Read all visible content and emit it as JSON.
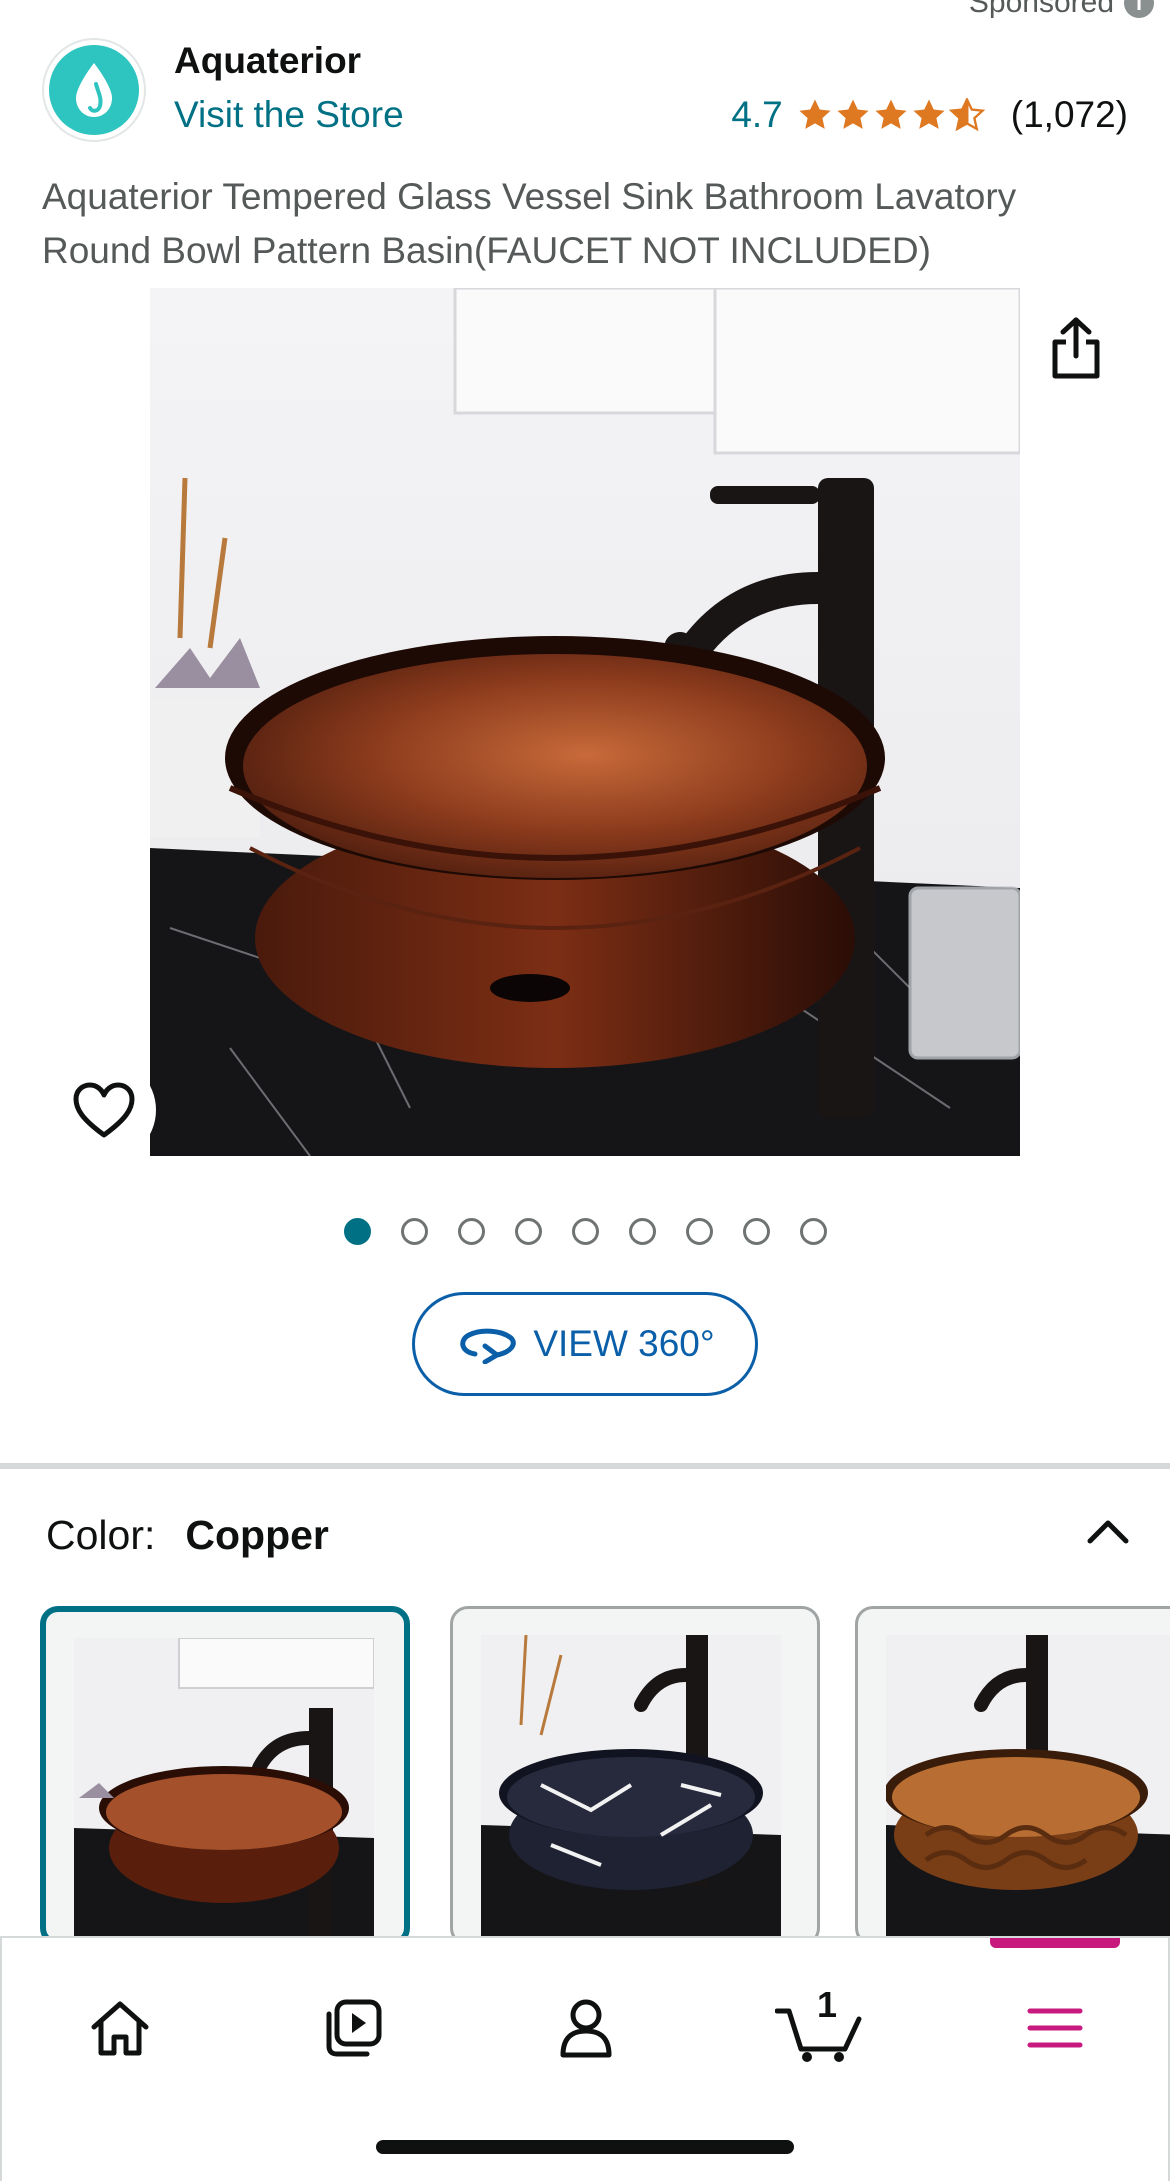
{
  "header": {
    "sponsored_label": "Sponsored",
    "brand_name": "Aquaterior",
    "visit_store_label": "Visit the Store",
    "rating_value": "4.7",
    "rating_stars": 4.7,
    "rating_count": "(1,072)"
  },
  "product": {
    "title": "Aquaterior Tempered Glass Vessel Sink Bathroom Lavatory Round Bowl Pattern Basin(FAUCET NOT INCLUDED)",
    "image_count": 9,
    "active_image_index": 0,
    "view360_label": "VIEW 360°"
  },
  "variants": {
    "label": "Color:",
    "selected": "Copper",
    "options": [
      "Copper",
      "Black Marble",
      "Bronze Pattern"
    ]
  },
  "bottom_nav": {
    "items": [
      "home-icon",
      "video-icon",
      "account-icon",
      "cart-icon",
      "menu-icon"
    ],
    "cart_count": "1",
    "active": "menu"
  },
  "colors": {
    "link": "#007185",
    "star": "#de7921",
    "accent_active": "#c7197e",
    "view360": "#0a5fa8"
  }
}
